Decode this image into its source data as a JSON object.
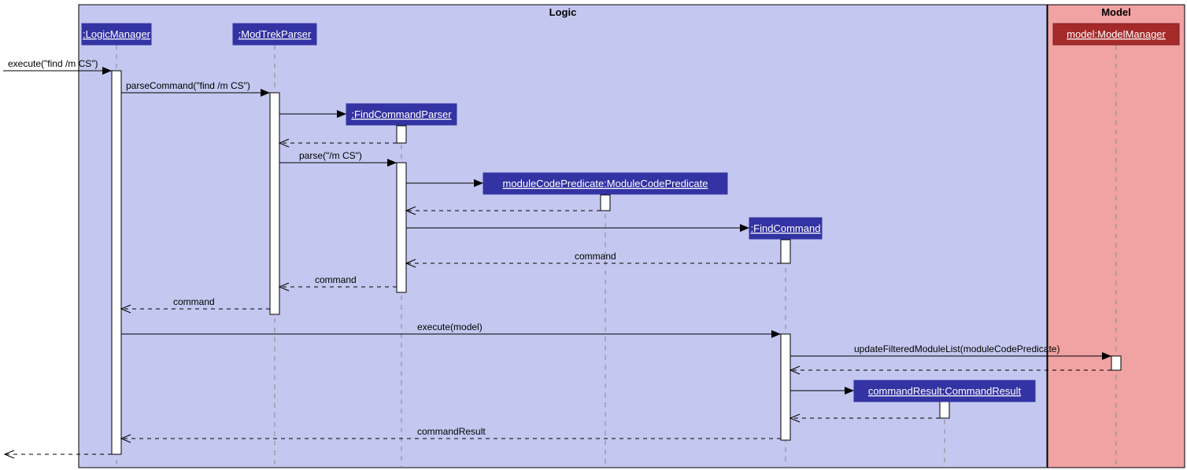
{
  "frames": {
    "logic": {
      "label": "Logic"
    },
    "model": {
      "label": "Model"
    }
  },
  "participants": {
    "logicManager": ":LogicManager",
    "modTrekParser": ":ModTrekParser",
    "findCommandParser": ":FindCommandParser",
    "moduleCodePredicate": "moduleCodePredicate:ModuleCodePredicate",
    "findCommand": ":FindCommand",
    "commandResult": "commandResult:CommandResult",
    "modelManager": "model:ModelManager"
  },
  "messages": {
    "m1": {
      "label": "execute(\"find /m CS\")",
      "type": "call"
    },
    "m2": {
      "label": "parseCommand(\"find /m CS\")",
      "type": "call"
    },
    "m3": {
      "label": "",
      "type": "create"
    },
    "m4": {
      "label": "",
      "type": "return"
    },
    "m5": {
      "label": "parse(\"/m CS\")",
      "type": "call"
    },
    "m6": {
      "label": "",
      "type": "create"
    },
    "m7": {
      "label": "",
      "type": "return"
    },
    "m8": {
      "label": "",
      "type": "create"
    },
    "m9": {
      "label": "command",
      "type": "return"
    },
    "m10": {
      "label": "command",
      "type": "return"
    },
    "m11": {
      "label": "command",
      "type": "return"
    },
    "m12": {
      "label": "execute(model)",
      "type": "call"
    },
    "m13": {
      "label": "updateFilteredModuleList(moduleCodePredicate)",
      "type": "call"
    },
    "m14": {
      "label": "",
      "type": "return"
    },
    "m15": {
      "label": "",
      "type": "create"
    },
    "m16": {
      "label": "",
      "type": "return"
    },
    "m17": {
      "label": "commandResult",
      "type": "return"
    },
    "m18": {
      "label": "",
      "type": "return"
    }
  }
}
